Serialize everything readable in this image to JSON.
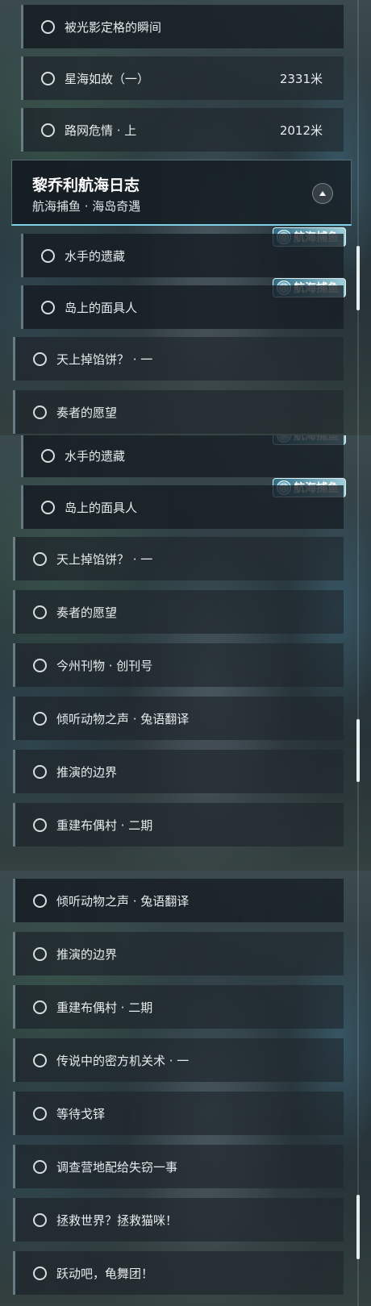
{
  "tag_label": "航海捕鱼",
  "panel1": {
    "rows_top": [
      {
        "label": "被光影定格的瞬间",
        "distance": ""
      },
      {
        "label": "星海如故（一）",
        "distance": "2331米"
      },
      {
        "label": "路网危情 · 上",
        "distance": "2012米"
      }
    ],
    "header": {
      "title": "黎乔利航海日志",
      "subtitle": "航海捕鱼 · 海岛奇遇"
    },
    "rows_mid": [
      {
        "label": "水手的遗藏"
      },
      {
        "label": "岛上的面具人"
      }
    ],
    "rows_bottom": [
      {
        "label": "天上掉馅饼？ · 一"
      },
      {
        "label": "奏者的愿望"
      }
    ]
  },
  "panel2": {
    "rows_mid": [
      {
        "label": "水手的遗藏"
      },
      {
        "label": "岛上的面具人"
      }
    ],
    "rows_bottom": [
      {
        "label": "天上掉馅饼？ · 一"
      },
      {
        "label": "奏者的愿望"
      },
      {
        "label": "今州刊物 · 创刊号"
      },
      {
        "label": "倾听动物之声 · 兔语翻译"
      },
      {
        "label": "推演的边界"
      },
      {
        "label": "重建布偶村 · 二期"
      }
    ]
  },
  "panel3": {
    "rows": [
      {
        "label": "倾听动物之声 · 兔语翻译"
      },
      {
        "label": "推演的边界"
      },
      {
        "label": "重建布偶村 · 二期"
      },
      {
        "label": "传说中的密方机关术 · 一"
      },
      {
        "label": "等待戈铎"
      },
      {
        "label": "调查营地配给失窃一事"
      },
      {
        "label": "拯救世界？拯救猫咪！"
      },
      {
        "label": "跃动吧，龟舞团！"
      }
    ]
  }
}
